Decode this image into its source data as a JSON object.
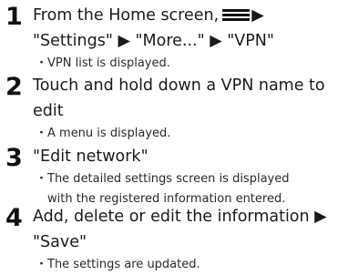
{
  "steps": [
    {
      "number": "1",
      "title_before_icon": "From the Home screen,",
      "icon": "menu-icon",
      "title_after_icon": "▶",
      "title_line2": "\"Settings\" ▶ \"More...\" ▶ \"VPN\"",
      "note_line1": "VPN list is displayed.",
      "note_line2": ""
    },
    {
      "number": "2",
      "title_line1": "Touch and hold down a VPN name to",
      "title_line2": "edit",
      "note_line1": "A menu is displayed.",
      "note_line2": ""
    },
    {
      "number": "3",
      "title_line1": "\"Edit network\"",
      "title_line2": "",
      "note_line1": "The detailed settings screen is displayed",
      "note_line2": "with the registered information entered."
    },
    {
      "number": "4",
      "title_line1": "Add, delete or edit the information ▶",
      "title_line2": "\"Save\"",
      "note_line1": "The settings are updated.",
      "note_line2": ""
    }
  ],
  "bullet": "・"
}
